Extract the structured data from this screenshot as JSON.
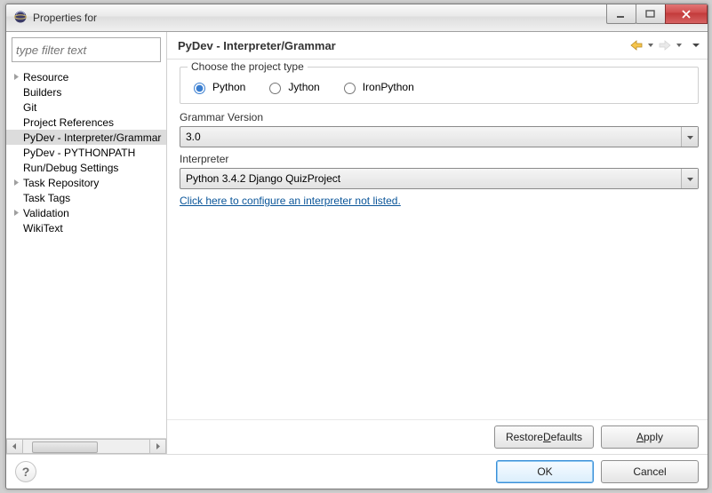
{
  "window": {
    "title": "Properties for"
  },
  "sidebar": {
    "filter_placeholder": "type filter text",
    "items": [
      {
        "label": "Resource",
        "expandable": true,
        "selected": false
      },
      {
        "label": "Builders",
        "expandable": false,
        "selected": false
      },
      {
        "label": "Git",
        "expandable": false,
        "selected": false
      },
      {
        "label": "Project References",
        "expandable": false,
        "selected": false
      },
      {
        "label": "PyDev - Interpreter/Grammar",
        "expandable": false,
        "selected": true
      },
      {
        "label": "PyDev - PYTHONPATH",
        "expandable": false,
        "selected": false
      },
      {
        "label": "Run/Debug Settings",
        "expandable": false,
        "selected": false
      },
      {
        "label": "Task Repository",
        "expandable": true,
        "selected": false
      },
      {
        "label": "Task Tags",
        "expandable": false,
        "selected": false
      },
      {
        "label": "Validation",
        "expandable": true,
        "selected": false
      },
      {
        "label": "WikiText",
        "expandable": false,
        "selected": false
      }
    ]
  },
  "main": {
    "heading": "PyDev - Interpreter/Grammar",
    "group_legend": "Choose the project type",
    "project_types": [
      {
        "label": "Python",
        "checked": true
      },
      {
        "label": "Jython",
        "checked": false
      },
      {
        "label": "IronPython",
        "checked": false
      }
    ],
    "grammar_label": "Grammar Version",
    "grammar_value": "3.0",
    "interpreter_label": "Interpreter",
    "interpreter_value": "Python 3.4.2 Django QuizProject",
    "config_link": "Click here to configure an interpreter not listed."
  },
  "buttons": {
    "restore_defaults_pre": "Restore ",
    "restore_defaults_mn": "D",
    "restore_defaults_post": "efaults",
    "apply_mn": "A",
    "apply_post": "pply",
    "ok": "OK",
    "cancel": "Cancel"
  }
}
